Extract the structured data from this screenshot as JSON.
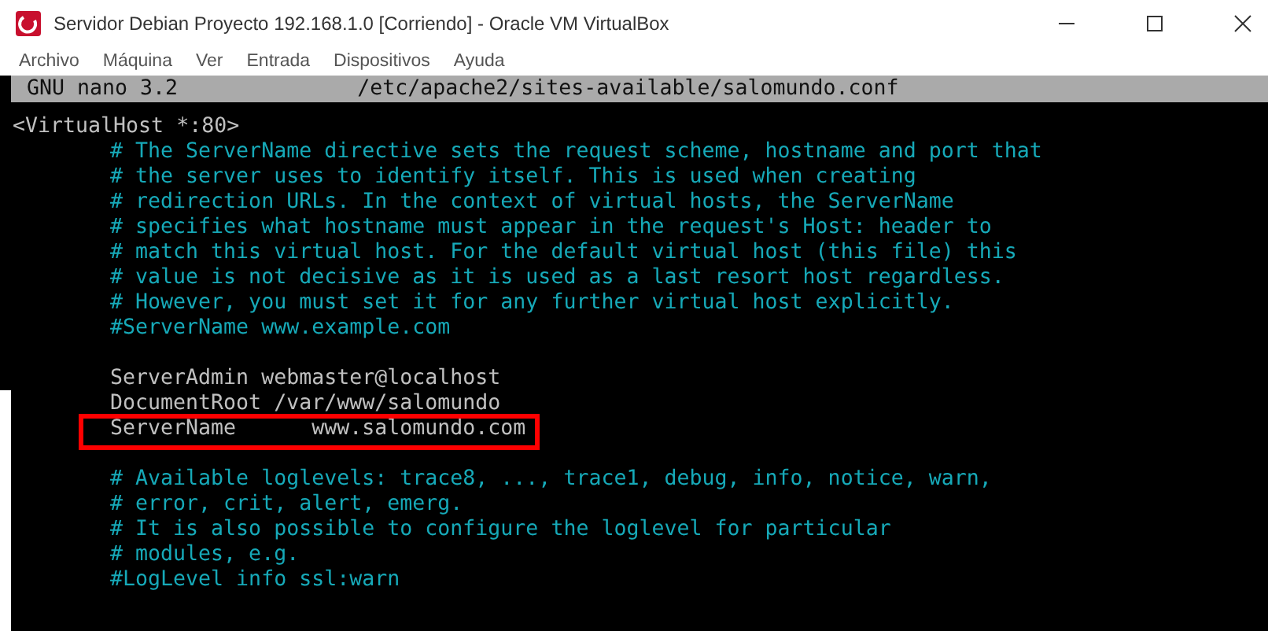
{
  "window": {
    "title": "Servidor Debian Proyecto 192.168.1.0 [Corriendo] - Oracle VM VirtualBox"
  },
  "menu": [
    "Archivo",
    "Máquina",
    "Ver",
    "Entrada",
    "Dispositivos",
    "Ayuda"
  ],
  "editor": {
    "app": "GNU nano 3.2",
    "file": "/etc/apache2/sites-available/salomundo.conf",
    "lines": [
      {
        "kind": "tag",
        "text": "<VirtualHost *:80>",
        "highlighted": false
      },
      {
        "kind": "comment",
        "text": "# The ServerName directive sets the request scheme, hostname and port that",
        "highlighted": false
      },
      {
        "kind": "comment",
        "text": "# the server uses to identify itself. This is used when creating",
        "highlighted": false
      },
      {
        "kind": "comment",
        "text": "# redirection URLs. In the context of virtual hosts, the ServerName",
        "highlighted": false
      },
      {
        "kind": "comment",
        "text": "# specifies what hostname must appear in the request's Host: header to",
        "highlighted": false
      },
      {
        "kind": "comment",
        "text": "# match this virtual host. For the default virtual host (this file) this",
        "highlighted": false
      },
      {
        "kind": "comment",
        "text": "# value is not decisive as it is used as a last resort host regardless.",
        "highlighted": false
      },
      {
        "kind": "comment",
        "text": "# However, you must set it for any further virtual host explicitly.",
        "highlighted": false
      },
      {
        "kind": "comment",
        "text": "#ServerName www.example.com",
        "highlighted": false
      },
      {
        "kind": "blank",
        "highlighted": false
      },
      {
        "kind": "directive",
        "text": "ServerAdmin webmaster@localhost",
        "highlighted": false
      },
      {
        "kind": "directive",
        "text": "DocumentRoot /var/www/salomundo",
        "highlighted": false
      },
      {
        "kind": "directive",
        "text": "ServerName      www.salomundo.com",
        "highlighted": true
      },
      {
        "kind": "blank",
        "highlighted": false
      },
      {
        "kind": "comment",
        "text": "# Available loglevels: trace8, ..., trace1, debug, info, notice, warn,",
        "highlighted": false
      },
      {
        "kind": "comment",
        "text": "# error, crit, alert, emerg.",
        "highlighted": false
      },
      {
        "kind": "comment",
        "text": "# It is also possible to configure the loglevel for particular",
        "highlighted": false
      },
      {
        "kind": "comment",
        "text": "# modules, e.g.",
        "highlighted": false
      },
      {
        "kind": "comment",
        "text": "#LogLevel info ssl:warn",
        "highlighted": false
      }
    ]
  }
}
